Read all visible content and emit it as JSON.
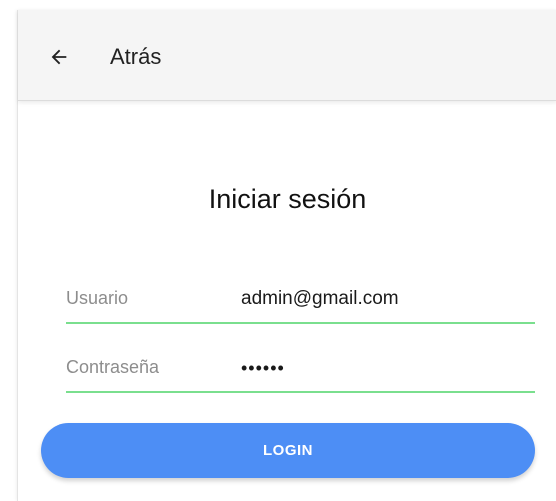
{
  "header": {
    "back_label": "Atrás",
    "back_icon": "arrow-left-icon"
  },
  "form": {
    "title": "Iniciar sesión",
    "username": {
      "label": "Usuario",
      "value": "admin@gmail.com"
    },
    "password": {
      "label": "Contraseña",
      "value": "••••••"
    },
    "submit_label": "LOGIN"
  },
  "colors": {
    "field_underline": "#7adf8e",
    "button_bg": "#4d8ef5",
    "topbar_bg": "#f5f5f5"
  }
}
